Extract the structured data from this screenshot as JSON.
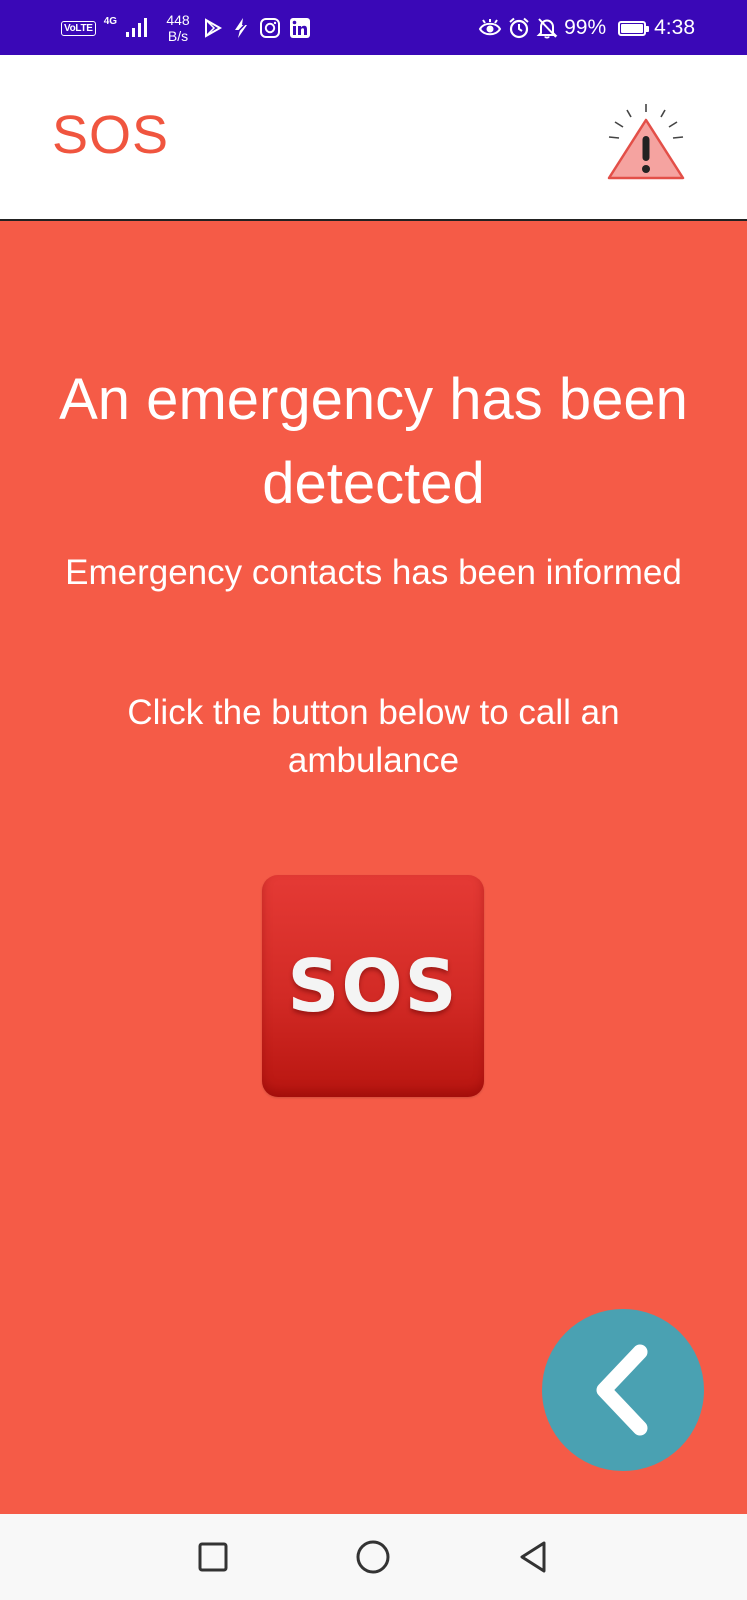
{
  "status_bar": {
    "volte": "VoLTE",
    "network": "4G",
    "speed_value": "448",
    "speed_unit": "B/s",
    "battery": "99%",
    "time": "4:38"
  },
  "app_bar": {
    "title": "SOS",
    "icon": "warning-triangle-icon"
  },
  "main": {
    "headline": "An emergency has been detected",
    "contacts_message": "Emergency contacts has been informed",
    "instruction": "Click the button below to call an ambulance",
    "sos_button_label": "SOS",
    "back_icon": "chevron-left-icon"
  },
  "nav_bar": {
    "icons": [
      "recents-square-icon",
      "home-circle-icon",
      "back-triangle-icon"
    ]
  },
  "colors": {
    "status_bar": "#3a08b7",
    "title": "#f0553f",
    "background": "#f55b47",
    "sos_button": "#d22a25",
    "fab": "#4aa1b2",
    "nav_bar": "#f8f8f8"
  }
}
